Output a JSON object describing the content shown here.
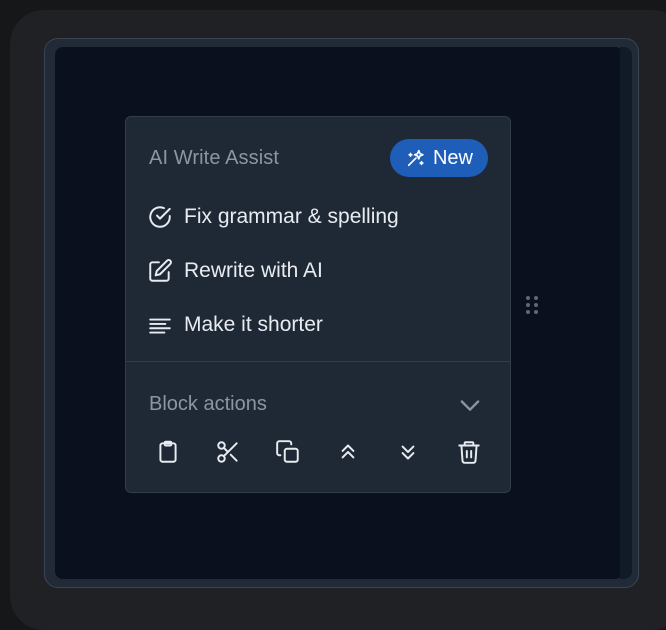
{
  "ai_section": {
    "title": "AI Write Assist",
    "badge": {
      "label": "New",
      "icon": "sparkle-icon",
      "color": "#1e5eb8"
    }
  },
  "ai_items": [
    {
      "label": "Fix grammar & spelling",
      "icon": "check-circle-icon"
    },
    {
      "label": "Rewrite with AI",
      "icon": "edit-icon"
    },
    {
      "label": "Make it shorter",
      "icon": "align-left-icon"
    }
  ],
  "block_section": {
    "title": "Block actions",
    "toggle_icon": "chevron-down-icon",
    "actions": [
      {
        "icon": "clipboard-icon"
      },
      {
        "icon": "scissors-icon"
      },
      {
        "icon": "copy-icon"
      },
      {
        "icon": "chevrons-up-icon"
      },
      {
        "icon": "chevrons-down-icon"
      },
      {
        "icon": "trash-icon"
      }
    ]
  },
  "theme": {
    "canvas": "#0a101d",
    "menu_bg": "#1f2936",
    "muted_text": "#8b95a3",
    "text": "#e8ecf1",
    "accent": "#1e5eb8"
  }
}
